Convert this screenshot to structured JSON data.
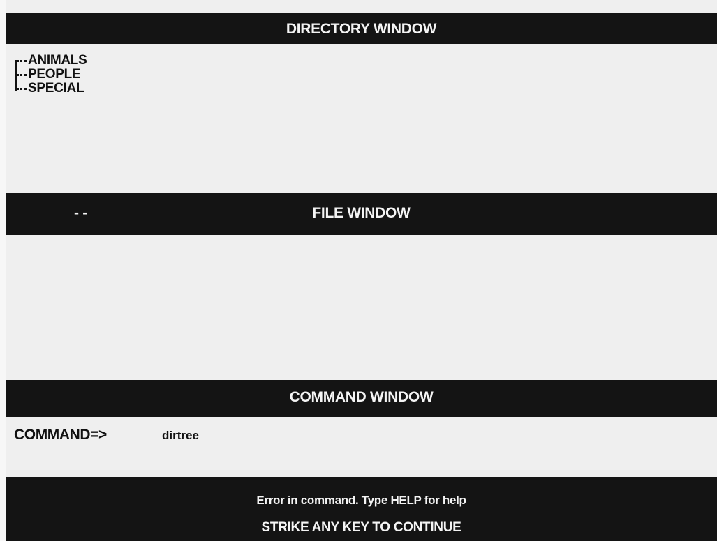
{
  "directory_window": {
    "title": "DIRECTORY WINDOW",
    "tree_items": [
      "ANIMALS",
      "PEOPLE",
      "SPECIAL"
    ]
  },
  "file_window": {
    "title": "FILE WINDOW",
    "marker": "- -"
  },
  "command_window": {
    "title": "COMMAND WINDOW",
    "prompt": "COMMAND=>",
    "value": "dirtree"
  },
  "status": {
    "error": "Error in command.  Type HELP for help",
    "continue": "STRIKE ANY KEY TO CONTINUE"
  }
}
